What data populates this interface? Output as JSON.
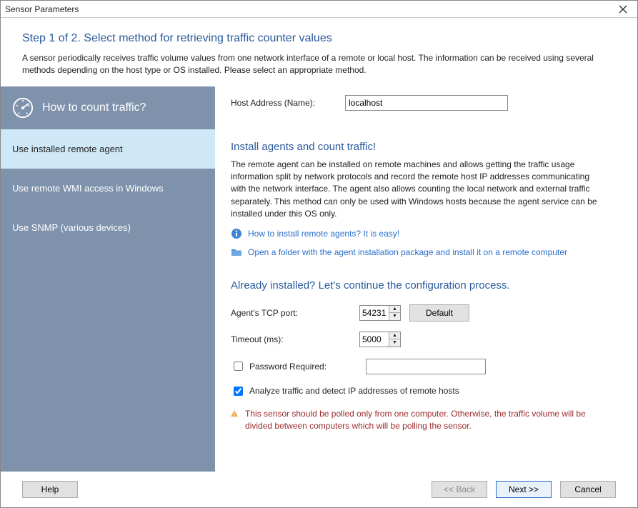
{
  "window": {
    "title": "Sensor Parameters"
  },
  "header": {
    "step_title": "Step 1 of 2. Select method for retrieving traffic counter values",
    "description": "A sensor periodically receives traffic volume values from one network interface of a remote or local host. The information can be received using several methods depending on the host type or OS installed. Please select an appropriate method."
  },
  "sidebar": {
    "heading": "How to count traffic?",
    "items": [
      {
        "label": "Use installed remote agent",
        "selected": true
      },
      {
        "label": "Use remote WMI access in Windows",
        "selected": false
      },
      {
        "label": "Use SNMP (various devices)",
        "selected": false
      }
    ]
  },
  "host": {
    "label": "Host Address (Name):",
    "value": "localhost"
  },
  "install_section": {
    "heading": "Install agents and count traffic!",
    "paragraph": "The remote agent can be installed on remote machines and allows getting the traffic usage information split by network protocols and record the remote host IP addresses communicating with the network interface. The agent also allows counting the local network and external traffic separately. This method can only be used with Windows hosts because the agent service can be installed under this OS only.",
    "link_howto": "How to install remote agents? It is easy!",
    "link_folder": "Open a folder with the agent installation package and install it on a remote computer"
  },
  "config_section": {
    "heading": "Already installed? Let's continue the configuration process.",
    "port_label": "Agent's TCP port:",
    "port_value": "54231",
    "default_button": "Default",
    "timeout_label": "Timeout (ms):",
    "timeout_value": "5000",
    "password_checkbox": "Password Required:",
    "password_checked": false,
    "password_value": "",
    "analyze_checkbox": "Analyze traffic and detect IP addresses of remote hosts",
    "analyze_checked": true,
    "warning": "This sensor should be polled only from one computer. Otherwise, the traffic volume will be divided between computers which will be polling the sensor."
  },
  "footer": {
    "help": "Help",
    "back": "<< Back",
    "next": "Next >>",
    "cancel": "Cancel"
  }
}
